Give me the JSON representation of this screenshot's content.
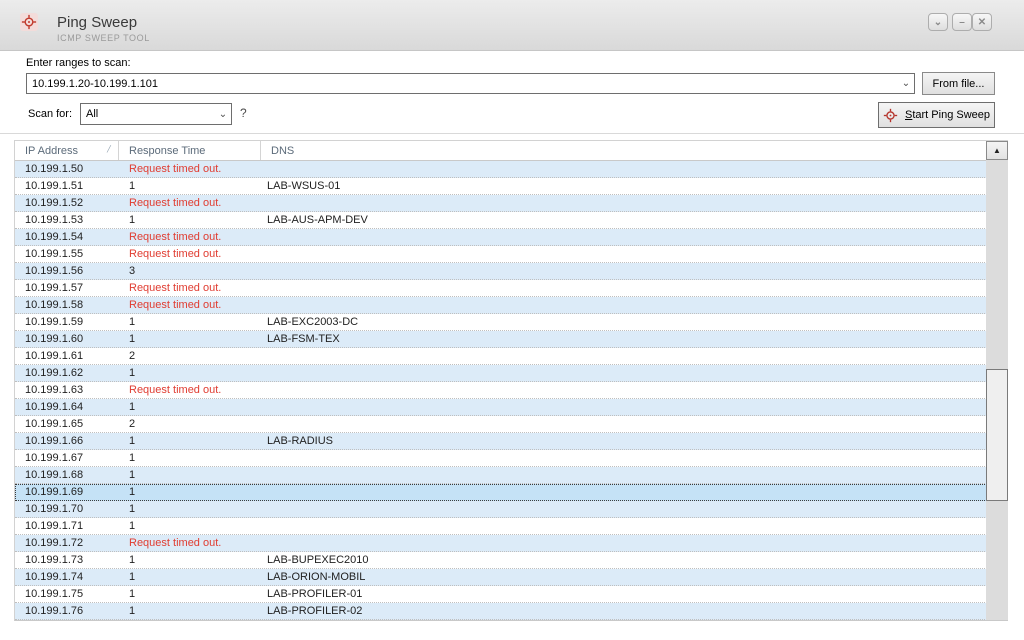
{
  "window": {
    "title": "Ping Sweep",
    "subtitle": "ICMP SWEEP TOOL",
    "controls": [
      {
        "name": "restore",
        "glyph": "⌄"
      },
      {
        "name": "minimize",
        "glyph": "–"
      },
      {
        "name": "close",
        "glyph": "✕"
      }
    ]
  },
  "form": {
    "ranges_label": "Enter ranges to scan:",
    "ranges_value": "10.199.1.20-10.199.1.101",
    "from_file_button": "From file...",
    "scan_for_label": "Scan for:",
    "scan_for_value": "All",
    "help_text": "?",
    "start_button_prefix": "S",
    "start_button_rest": "tart Ping Sweep"
  },
  "table": {
    "columns": {
      "ip": "IP Address",
      "response": "Response Time",
      "dns": "DNS"
    },
    "sort_glyph": "∕",
    "rows": [
      {
        "ip": "10.199.1.50",
        "response": "Request timed out.",
        "dns": "",
        "timeout": true
      },
      {
        "ip": "10.199.1.51",
        "response": "1",
        "dns": "LAB-WSUS-01"
      },
      {
        "ip": "10.199.1.52",
        "response": "Request timed out.",
        "dns": "",
        "timeout": true
      },
      {
        "ip": "10.199.1.53",
        "response": "1",
        "dns": "LAB-AUS-APM-DEV"
      },
      {
        "ip": "10.199.1.54",
        "response": "Request timed out.",
        "dns": "",
        "timeout": true
      },
      {
        "ip": "10.199.1.55",
        "response": "Request timed out.",
        "dns": "",
        "timeout": true
      },
      {
        "ip": "10.199.1.56",
        "response": "3",
        "dns": ""
      },
      {
        "ip": "10.199.1.57",
        "response": "Request timed out.",
        "dns": "",
        "timeout": true
      },
      {
        "ip": "10.199.1.58",
        "response": "Request timed out.",
        "dns": "",
        "timeout": true
      },
      {
        "ip": "10.199.1.59",
        "response": "1",
        "dns": "LAB-EXC2003-DC"
      },
      {
        "ip": "10.199.1.60",
        "response": "1",
        "dns": "LAB-FSM-TEX"
      },
      {
        "ip": "10.199.1.61",
        "response": "2",
        "dns": ""
      },
      {
        "ip": "10.199.1.62",
        "response": "1",
        "dns": ""
      },
      {
        "ip": "10.199.1.63",
        "response": "Request timed out.",
        "dns": "",
        "timeout": true
      },
      {
        "ip": "10.199.1.64",
        "response": "1",
        "dns": ""
      },
      {
        "ip": "10.199.1.65",
        "response": "2",
        "dns": ""
      },
      {
        "ip": "10.199.1.66",
        "response": "1",
        "dns": "LAB-RADIUS"
      },
      {
        "ip": "10.199.1.67",
        "response": "1",
        "dns": ""
      },
      {
        "ip": "10.199.1.68",
        "response": "1",
        "dns": ""
      },
      {
        "ip": "10.199.1.69",
        "response": "1",
        "dns": "",
        "selected": true
      },
      {
        "ip": "10.199.1.70",
        "response": "1",
        "dns": ""
      },
      {
        "ip": "10.199.1.71",
        "response": "1",
        "dns": ""
      },
      {
        "ip": "10.199.1.72",
        "response": "Request timed out.",
        "dns": "",
        "timeout": true
      },
      {
        "ip": "10.199.1.73",
        "response": "1",
        "dns": "LAB-BUPEXEC2010"
      },
      {
        "ip": "10.199.1.74",
        "response": "1",
        "dns": "LAB-ORION-MOBIL"
      },
      {
        "ip": "10.199.1.75",
        "response": "1",
        "dns": "LAB-PROFILER-01"
      },
      {
        "ip": "10.199.1.76",
        "response": "1",
        "dns": "LAB-PROFILER-02"
      }
    ]
  },
  "colors": {
    "accent_red": "#c0392b",
    "timeout_text": "#e03c31",
    "row_alt": "#dcebf8",
    "row_selected": "#c5e2f6",
    "header_text": "#5c6b7a",
    "titlebar_top": "#ececec",
    "titlebar_bottom": "#d9d9d9"
  }
}
